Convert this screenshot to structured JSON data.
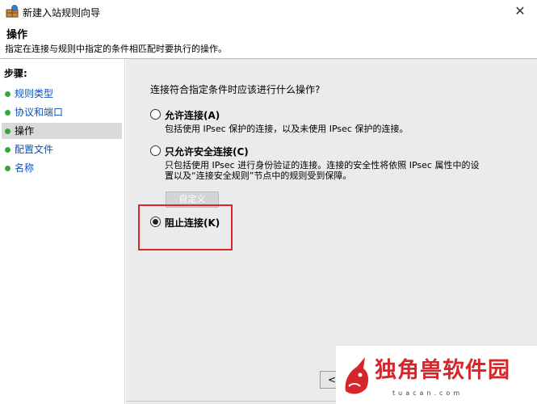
{
  "window": {
    "title": "新建入站规则向导",
    "close_glyph": "✕"
  },
  "header": {
    "title": "操作",
    "description": "指定在连接与规则中指定的条件相匹配时要执行的操作。"
  },
  "sidebar": {
    "steps_label": "步骤:",
    "items": [
      {
        "label": "规则类型",
        "state": "link"
      },
      {
        "label": "协议和端口",
        "state": "link"
      },
      {
        "label": "操作",
        "state": "active"
      },
      {
        "label": "配置文件",
        "state": "link"
      },
      {
        "label": "名称",
        "state": "link"
      }
    ]
  },
  "main": {
    "question": "连接符合指定条件时应该进行什么操作?",
    "options": [
      {
        "label": "允许连接(A)",
        "description": "包括使用 IPsec 保护的连接，以及未使用 IPsec 保护的连接。",
        "checked": false
      },
      {
        "label": "只允许安全连接(C)",
        "description_line1": "只包括使用 IPsec 进行身份验证的连接。连接的安全性将依照 IPsec 属性中的设",
        "description_line2": "置以及“连接安全规则”节点中的规则受到保障。",
        "checked": false
      },
      {
        "label": "阻止连接(K)",
        "checked": true
      }
    ],
    "customize_label": "自定义",
    "back_label": "<"
  },
  "colors": {
    "highlight": "#d8272a",
    "step_dot": "#36a836",
    "link": "#0a4fbd"
  },
  "watermark": {
    "text": "独角兽软件园",
    "subtext": "tuacan.com"
  }
}
